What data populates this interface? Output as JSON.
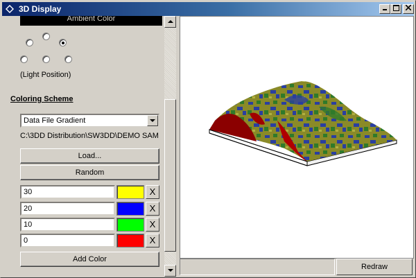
{
  "window": {
    "title": "3D Display"
  },
  "panel": {
    "ambient_label": "Ambient Color",
    "light_position_label": "(Light Position)",
    "light_positions": [
      "top-left",
      "top",
      "top-right",
      "left",
      "center",
      "right"
    ],
    "light_selected": "top-right",
    "coloring_title": "Coloring Scheme",
    "scheme_selected": "Data File Gradient",
    "file_path": "C:\\3DD Distribution\\SW3DD\\DEMO SAM",
    "load_label": "Load...",
    "random_label": "Random",
    "rows": [
      {
        "value": "30",
        "color": "#ffff00",
        "remove": "X"
      },
      {
        "value": "20",
        "color": "#0000ff",
        "remove": "X"
      },
      {
        "value": "10",
        "color": "#00ff00",
        "remove": "X"
      },
      {
        "value": "0",
        "color": "#ff0000",
        "remove": "X"
      }
    ],
    "add_color_label": "Add Color"
  },
  "footer": {
    "redraw_label": "Redraw"
  }
}
